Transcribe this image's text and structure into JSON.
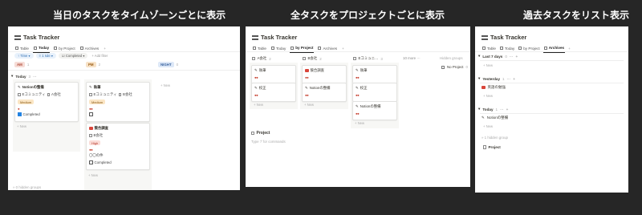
{
  "captions": {
    "left": "当日のタスクをタイムゾーンごとに表示",
    "middle": "全タスクをプロジェクトごとに表示",
    "right": "過去タスクをリスト表示"
  },
  "screens": {
    "left": {
      "title": "Task Tracker",
      "tabs": [
        {
          "label": "Table",
          "active": false
        },
        {
          "label": "Today",
          "active": true
        },
        {
          "label": "by Project",
          "active": false
        },
        {
          "label": "Archives",
          "active": false
        }
      ],
      "filters": {
        "time": "Time",
        "rule": "1 rule",
        "completed": "Completed",
        "add": "+ Add filter"
      },
      "columns": [
        {
          "label": "AM",
          "count": "1",
          "color": "#f6dcd6",
          "text": "#b14b38"
        },
        {
          "label": "PM",
          "count": "2",
          "color": "#f7e2c7",
          "text": "#9a5b12"
        },
        {
          "label": "NIGHT",
          "count": "0",
          "color": "#dde8f7",
          "text": "#3a64a0"
        }
      ],
      "group": {
        "label": "Today",
        "count": "3"
      },
      "cards": {
        "c1": {
          "title": "Notionの整備",
          "tag1": "Eコミュニティ",
          "tag2": "A会社",
          "badge": "Medium",
          "status": "Completed",
          "dots": "●"
        },
        "c2": {
          "title": "執筆",
          "tag1": "Eコミュニティ",
          "tag2": "B会社",
          "badge": "Medium",
          "dots": "●●"
        },
        "c3": {
          "title": "競合調査",
          "tag1": "B会社",
          "badge": "High",
          "dots": "●●",
          "extra": "〇〇の件",
          "status": "Completed"
        }
      },
      "new_label": "+ New",
      "hidden": "» 0 hidden groups"
    },
    "middle": {
      "title": "Task Tracker",
      "tabs": [
        {
          "label": "Table",
          "active": false
        },
        {
          "label": "Today",
          "active": false
        },
        {
          "label": "by Project",
          "active": true
        },
        {
          "label": "Archives",
          "active": false
        }
      ],
      "columns": [
        {
          "label": "A会社",
          "count": "2"
        },
        {
          "label": "B会社",
          "count": "2"
        },
        {
          "label": "Eコミュニ…",
          "count": "3"
        }
      ],
      "more": "10 more ···",
      "hidden_groups": "Hidden groups",
      "no_project": "No Project",
      "no_project_count": "0",
      "cards": {
        "a1": {
          "title": "執筆",
          "dots": "●●"
        },
        "a2": {
          "title": "校正",
          "dots": "●●"
        },
        "b1": {
          "title": "競合調査",
          "dots": "●●"
        },
        "b2": {
          "title": "Notionの整備",
          "dots": "●●"
        },
        "e1": {
          "title": "執筆",
          "dots": "●●"
        },
        "e2": {
          "title": "校正",
          "dots": "●●"
        },
        "e3": {
          "title": "Notionの整備",
          "dots": "●●"
        }
      },
      "new_label": "+ New",
      "project_heading": "Project",
      "project_hint": "Type '/' for commands"
    },
    "right": {
      "title": "Task Tracker",
      "tabs": [
        {
          "label": "Table",
          "active": false
        },
        {
          "label": "Today",
          "active": false
        },
        {
          "label": "by Project",
          "active": false
        },
        {
          "label": "Archives",
          "active": true
        }
      ],
      "groups": [
        {
          "label": "Last 7 days",
          "count": "0"
        },
        {
          "label": "Yesterday",
          "count": "1",
          "item": "英語の勉強"
        },
        {
          "label": "Today",
          "count": "1",
          "item": "Notionの整備"
        }
      ],
      "new_label": "+ New",
      "hidden": "» 1 hidden group",
      "project": "Project"
    }
  }
}
